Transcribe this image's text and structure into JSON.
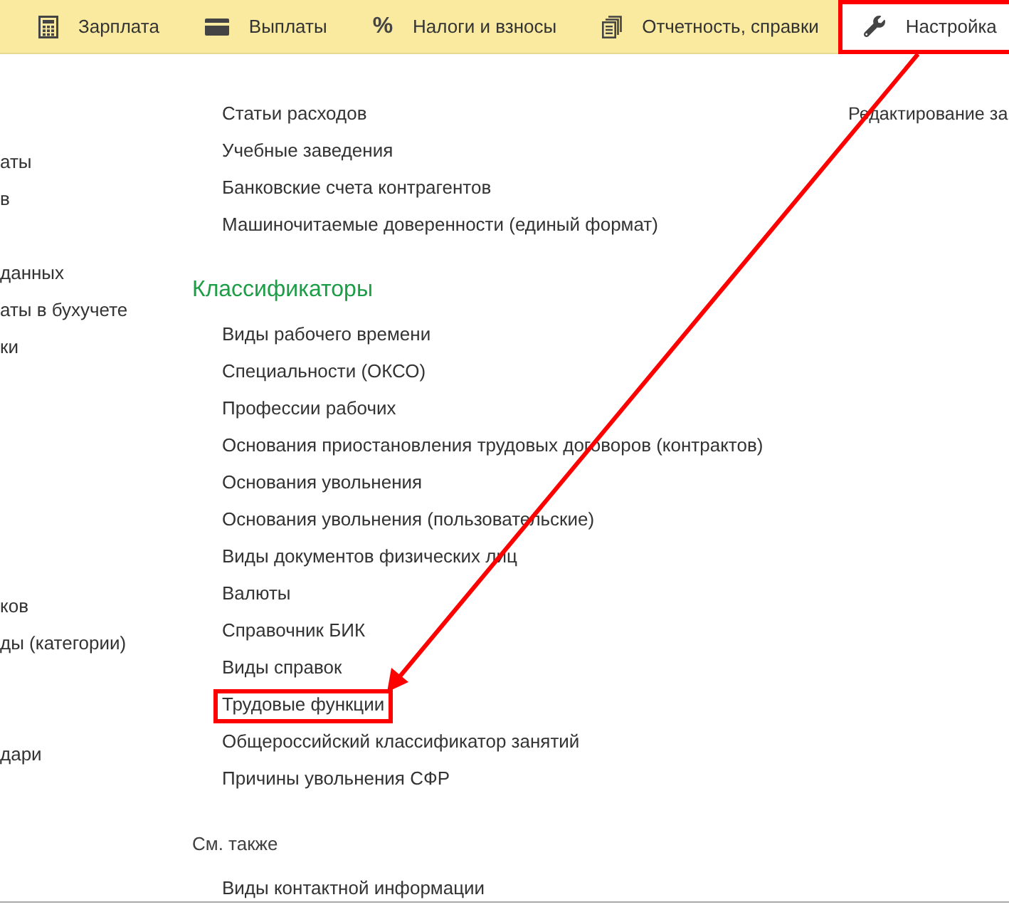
{
  "tabs": [
    {
      "label": "Зарплата",
      "kind": "calculator",
      "selected": false,
      "highlighted": false
    },
    {
      "label": "Выплаты",
      "kind": "card",
      "selected": false,
      "highlighted": false
    },
    {
      "label": "Налоги и взносы",
      "kind": "glyph",
      "glyph": "%",
      "selected": false,
      "highlighted": false
    },
    {
      "label": "Отчетность, справки",
      "kind": "documents",
      "selected": false,
      "highlighted": false
    },
    {
      "label": "Настройка",
      "kind": "wrench",
      "selected": true,
      "highlighted": true
    }
  ],
  "left_column": {
    "groups": [
      [
        "аты",
        "в"
      ],
      [
        "данных",
        "аты в бухучете",
        "ки"
      ],
      [
        "ков",
        "ды (категории)"
      ],
      [
        "дари"
      ]
    ]
  },
  "middle_column": {
    "sections": [
      {
        "kind": "continued",
        "items": [
          {
            "label": "Статьи расходов",
            "highlighted": false
          },
          {
            "label": "Учебные заведения",
            "highlighted": false
          },
          {
            "label": "Банковские счета контрагентов",
            "highlighted": false
          },
          {
            "label": "Машиночитаемые доверенности (единый формат)",
            "highlighted": false
          }
        ]
      },
      {
        "kind": "group",
        "heading": "Классификаторы",
        "items": [
          {
            "label": "Виды рабочего времени",
            "highlighted": false
          },
          {
            "label": "Специальности (ОКСО)",
            "highlighted": false
          },
          {
            "label": "Профессии рабочих",
            "highlighted": false
          },
          {
            "label": "Основания приостановления трудовых договоров (контрактов)",
            "highlighted": false
          },
          {
            "label": "Основания увольнения",
            "highlighted": false
          },
          {
            "label": "Основания увольнения (пользовательские)",
            "highlighted": false
          },
          {
            "label": "Виды документов физических лиц",
            "highlighted": false
          },
          {
            "label": "Валюты",
            "highlighted": false
          },
          {
            "label": "Справочник БИК",
            "highlighted": false
          },
          {
            "label": "Виды справок",
            "highlighted": false
          },
          {
            "label": "Трудовые функции",
            "highlighted": true
          },
          {
            "label": "Общероссийский классификатор занятий",
            "highlighted": false
          },
          {
            "label": "Причины увольнения СФР",
            "highlighted": false
          }
        ]
      },
      {
        "kind": "see_also",
        "heading": "См. также",
        "items": [
          {
            "label": "Виды контактной информации",
            "highlighted": false
          }
        ]
      }
    ]
  },
  "right_column": {
    "items": [
      "Редактирование за"
    ]
  }
}
